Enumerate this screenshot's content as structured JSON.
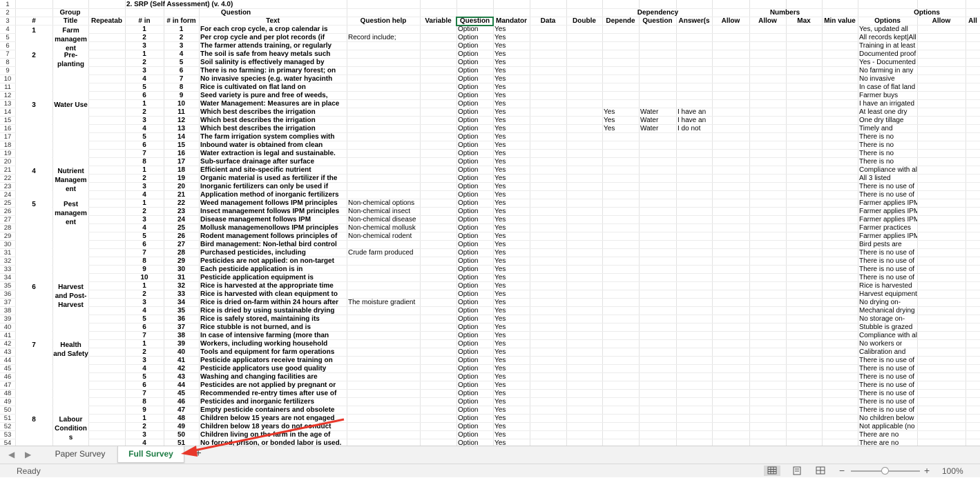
{
  "colors": {
    "accent": "#1e7c45",
    "annotation_arrow": "#e8382b"
  },
  "sheet": {
    "title": "2. SRP (Self Assessment) (v. 4.0)",
    "group_header": "Group",
    "question_header": "Question",
    "dependency_header": "Dependency",
    "numbers_header": "Numbers",
    "options_header": "Options",
    "headers": [
      "#",
      "Title",
      "Repeatab",
      "# in",
      "# in form",
      "Text",
      "Question help",
      "Variable",
      "Question",
      "Mandator",
      "Data",
      "Double",
      "Depende",
      "Question",
      "Answer(s",
      "Allow",
      "Allow",
      "Max",
      "Min value",
      "Options",
      "Allow",
      "All"
    ],
    "row_numbers": [
      "1",
      "2",
      "3",
      "4",
      "5",
      "6",
      "7",
      "8",
      "9",
      "10",
      "11",
      "12",
      "13",
      "14",
      "15",
      "16",
      "17",
      "18",
      "19",
      "20",
      "21",
      "22",
      "23",
      "24",
      "25",
      "26",
      "27",
      "28",
      "29",
      "30",
      "31",
      "32",
      "33",
      "34",
      "35",
      "36",
      "37",
      "38",
      "39",
      "40",
      "41",
      "42",
      "43",
      "44",
      "45",
      "46",
      "47",
      "48",
      "49",
      "50",
      "51",
      "52",
      "53",
      "54"
    ],
    "groups": [
      {
        "num": "1",
        "title": "Farm managem ent"
      },
      {
        "num": "2",
        "title": "Pre-planting"
      },
      {
        "num": "3",
        "title": "Water Use"
      },
      {
        "num": "4",
        "title": "Nutrient Managem ent"
      },
      {
        "num": "5",
        "title": "Pest managem ent"
      },
      {
        "num": "6",
        "title": "Harvest and Post-Harvest"
      },
      {
        "num": "7",
        "title": "Health and Safety"
      },
      {
        "num": "8",
        "title": "Labour Condition s"
      }
    ],
    "rows": [
      [
        "1",
        "1",
        "For each crop cycle, a crop calendar is",
        "",
        "Option",
        "Yes",
        "",
        "",
        "",
        "Yes, updated all"
      ],
      [
        "2",
        "2",
        "Per crop cycle and per plot records (if",
        "Record include;",
        "Option",
        "Yes",
        "",
        "",
        "",
        "All records kept|All"
      ],
      [
        "3",
        "3",
        "The farmer attends training, or regularly",
        "",
        "Option",
        "Yes",
        "",
        "",
        "",
        "Training in at least"
      ],
      [
        "1",
        "4",
        "The soil is safe from heavy metals such",
        "",
        "Option",
        "Yes",
        "",
        "",
        "",
        "Documented proof"
      ],
      [
        "2",
        "5",
        "Soil salinity is effectively managed by",
        "",
        "Option",
        "Yes",
        "",
        "",
        "",
        "Yes - Documented"
      ],
      [
        "3",
        "6",
        "There is no farming: in primary forest; on",
        "",
        "Option",
        "Yes",
        "",
        "",
        "",
        "No farming in any"
      ],
      [
        "4",
        "7",
        "No invasive species (e.g. water hyacinth",
        "",
        "Option",
        "Yes",
        "",
        "",
        "",
        "No invasive"
      ],
      [
        "5",
        "8",
        "Rice is cultivated on flat land on",
        "",
        "Option",
        "Yes",
        "",
        "",
        "",
        "In case of flat land"
      ],
      [
        "6",
        "9",
        "Seed variety is pure and free of weeds,",
        "",
        "Option",
        "Yes",
        "",
        "",
        "",
        "Farmer buys"
      ],
      [
        "1",
        "10",
        "Water Management: Measures are in place",
        "",
        "Option",
        "Yes",
        "",
        "",
        "",
        "I have an irrigated"
      ],
      [
        "2",
        "11",
        "Which best describes the irrigation",
        "",
        "Option",
        "Yes",
        "Yes",
        "Water",
        "I have an",
        "At least one dry"
      ],
      [
        "3",
        "12",
        "Which best describes the irrigation",
        "",
        "Option",
        "Yes",
        "Yes",
        "Water",
        "I have an",
        "One dry tillage"
      ],
      [
        "4",
        "13",
        "Which best describes the irrigation",
        "",
        "Option",
        "Yes",
        "Yes",
        "Water",
        "I do not",
        "Timely and"
      ],
      [
        "5",
        "14",
        "The farm irrigation system complies with",
        "",
        "Option",
        "Yes",
        "",
        "",
        "",
        "There is no"
      ],
      [
        "6",
        "15",
        "Inbound water is obtained from clean",
        "",
        "Option",
        "Yes",
        "",
        "",
        "",
        "There is no"
      ],
      [
        "7",
        "16",
        "Water extraction is legal and sustainable.",
        "",
        "Option",
        "Yes",
        "",
        "",
        "",
        "There is no"
      ],
      [
        "8",
        "17",
        "Sub-surface drainage after surface",
        "",
        "Option",
        "Yes",
        "",
        "",
        "",
        "There is no"
      ],
      [
        "1",
        "18",
        "Efficient and site-specific nutrient",
        "",
        "Option",
        "Yes",
        "",
        "",
        "",
        "Compliance with all"
      ],
      [
        "2",
        "19",
        "Organic material is used as fertilizer if the",
        "",
        "Option",
        "Yes",
        "",
        "",
        "",
        "All 3 listed"
      ],
      [
        "3",
        "20",
        "Inorganic fertilizers can only be used if",
        "",
        "Option",
        "Yes",
        "",
        "",
        "",
        "There is no use of"
      ],
      [
        "4",
        "21",
        "Application method of inorganic fertilizers",
        "",
        "Option",
        "Yes",
        "",
        "",
        "",
        "There is no use of"
      ],
      [
        "1",
        "22",
        "Weed management follows IPM principles",
        "Non-chemical options",
        "Option",
        "Yes",
        "",
        "",
        "",
        "Farmer applies IPM"
      ],
      [
        "2",
        "23",
        "Insect management follows IPM principles",
        "Non-chemical insect",
        "Option",
        "Yes",
        "",
        "",
        "",
        "Farmer applies IPM"
      ],
      [
        "3",
        "24",
        "Disease management follows IPM",
        "Non-chemical disease",
        "Option",
        "Yes",
        "",
        "",
        "",
        "Farmer applies IPM"
      ],
      [
        "4",
        "25",
        "Mollusk managemenollows IPM principles",
        "Non-chemical mollusk",
        "Option",
        "Yes",
        "",
        "",
        "",
        "Farmer practices"
      ],
      [
        "5",
        "26",
        "Rodent management follows principles of",
        "Non-chemical rodent",
        "Option",
        "Yes",
        "",
        "",
        "",
        "Farmer applies IPM"
      ],
      [
        "6",
        "27",
        "Bird management: Non-lethal bird control",
        "",
        "Option",
        "Yes",
        "",
        "",
        "",
        "Bird pests are"
      ],
      [
        "7",
        "28",
        "Purchased pesticides, including",
        "Crude farm produced",
        "Option",
        "Yes",
        "",
        "",
        "",
        "There is no use of"
      ],
      [
        "8",
        "29",
        "Pesticides are not applied: on non-target",
        "",
        "Option",
        "Yes",
        "",
        "",
        "",
        "There is no use of"
      ],
      [
        "9",
        "30",
        "Each pesticide application is in",
        "",
        "Option",
        "Yes",
        "",
        "",
        "",
        "There is no use of"
      ],
      [
        "10",
        "31",
        "Pesticide application equipment is",
        "",
        "Option",
        "Yes",
        "",
        "",
        "",
        "There is no use of"
      ],
      [
        "1",
        "32",
        "Rice is harvested at the appropriate time",
        "",
        "Option",
        "Yes",
        "",
        "",
        "",
        "Rice is harvested"
      ],
      [
        "2",
        "33",
        "Rice is harvested with clean equipment to",
        "",
        "Option",
        "Yes",
        "",
        "",
        "",
        "Harvest equipment"
      ],
      [
        "3",
        "34",
        "Rice is dried on-farm within 24 hours after",
        "The moisture gradient",
        "Option",
        "Yes",
        "",
        "",
        "",
        "No drying on-"
      ],
      [
        "4",
        "35",
        "Rice is dried by using sustainable drying",
        "",
        "Option",
        "Yes",
        "",
        "",
        "",
        "Mechanical drying"
      ],
      [
        "5",
        "36",
        "Rice is safely stored, maintaining its",
        "",
        "Option",
        "Yes",
        "",
        "",
        "",
        "No storage on-"
      ],
      [
        "6",
        "37",
        "Rice stubble is not burned, and is",
        "",
        "Option",
        "Yes",
        "",
        "",
        "",
        "Stubble is grazed"
      ],
      [
        "7",
        "38",
        "In case of intensive farming (more than",
        "",
        "Option",
        "Yes",
        "",
        "",
        "",
        "Compliance with all"
      ],
      [
        "1",
        "39",
        "Workers, including working household",
        "",
        "Option",
        "Yes",
        "",
        "",
        "",
        "No workers or"
      ],
      [
        "2",
        "40",
        "Tools and equipment for farm operations",
        "",
        "Option",
        "Yes",
        "",
        "",
        "",
        "Calibration and"
      ],
      [
        "3",
        "41",
        "Pesticide applicators receive training on",
        "",
        "Option",
        "Yes",
        "",
        "",
        "",
        "There is no use of"
      ],
      [
        "4",
        "42",
        "Pesticide applicators use good quality",
        "",
        "Option",
        "Yes",
        "",
        "",
        "",
        "There is no use of"
      ],
      [
        "5",
        "43",
        "Washing and changing facilities are",
        "",
        "Option",
        "Yes",
        "",
        "",
        "",
        "There is no use of"
      ],
      [
        "6",
        "44",
        "Pesticides are not applied by pregnant or",
        "",
        "Option",
        "Yes",
        "",
        "",
        "",
        "There is no use of"
      ],
      [
        "7",
        "45",
        "Recommended re-entry times after use of",
        "",
        "Option",
        "Yes",
        "",
        "",
        "",
        "There is no use of"
      ],
      [
        "8",
        "46",
        "Pesticides and inorganic fertilizers",
        "",
        "Option",
        "Yes",
        "",
        "",
        "",
        "There is no use of"
      ],
      [
        "9",
        "47",
        "Empty pesticide containers and obsolete",
        "",
        "Option",
        "Yes",
        "",
        "",
        "",
        "There is no use of"
      ],
      [
        "1",
        "48",
        "Children below 15 years are not engaged",
        "",
        "Option",
        "Yes",
        "",
        "",
        "",
        "No children below"
      ],
      [
        "2",
        "49",
        "Children below 18 years do not conduct",
        "",
        "Option",
        "Yes",
        "",
        "",
        "",
        "Not applicable (no"
      ],
      [
        "3",
        "50",
        "Children living on the farm in the age of",
        "",
        "Option",
        "Yes",
        "",
        "",
        "",
        "There are no"
      ],
      [
        "4",
        "51",
        "No forced, prison, or bonded labor is used.",
        "",
        "Option",
        "Yes",
        "",
        "",
        "",
        "There are no"
      ]
    ]
  },
  "tabs": {
    "paper": "Paper Survey",
    "full": "Full Survey",
    "add": "+"
  },
  "status": {
    "ready": "Ready",
    "zoom": "100%",
    "zoom_level_percent": 100
  }
}
